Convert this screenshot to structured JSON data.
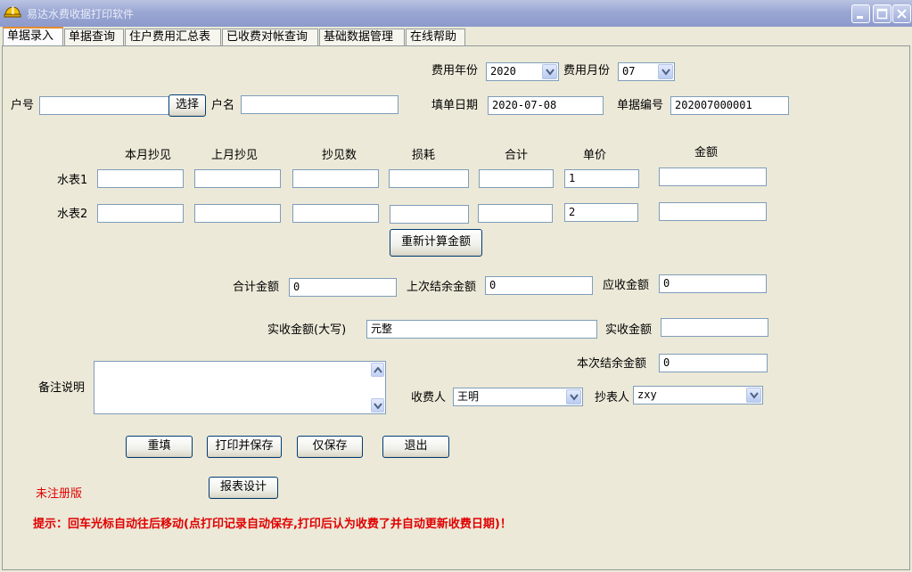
{
  "window": {
    "title": "易达水费收据打印软件"
  },
  "tabs": [
    {
      "label": "单据录入",
      "active": true
    },
    {
      "label": "单据查询"
    },
    {
      "label": "住户费用汇总表"
    },
    {
      "label": "已收费对帐查询"
    },
    {
      "label": "基础数据管理"
    },
    {
      "label": "在线帮助"
    }
  ],
  "form": {
    "fee_year_label": "费用年份",
    "fee_year_value": "2020",
    "fee_month_label": "费用月份",
    "fee_month_value": "07",
    "account_no_label": "户号",
    "account_no_value": "",
    "select_button": "选择",
    "account_name_label": "户名",
    "account_name_value": "",
    "fill_date_label": "填单日期",
    "fill_date_value": "2020-07-08",
    "doc_no_label": "单据编号",
    "doc_no_value": "202007000001"
  },
  "meter_table": {
    "headers": [
      "本月抄见",
      "上月抄见",
      "抄见数",
      "损耗",
      "合计",
      "单价",
      "金额"
    ],
    "rows": [
      {
        "label": "水表1",
        "values": [
          "",
          "",
          "",
          "",
          "",
          "1",
          ""
        ]
      },
      {
        "label": "水表2",
        "values": [
          "",
          "",
          "",
          "",
          "",
          "2",
          ""
        ]
      }
    ],
    "recalc_button": "重新计算金额"
  },
  "totals": {
    "total_amount_label": "合计金额",
    "total_amount_value": "0",
    "last_balance_label": "上次结余金额",
    "last_balance_value": "0",
    "receivable_label": "应收金额",
    "receivable_value": "0",
    "paid_upper_label": "实收金额(大写)",
    "paid_upper_value": "元整",
    "paid_label": "实收金额",
    "paid_value": "",
    "this_balance_label": "本次结余金额",
    "this_balance_value": "0"
  },
  "remark": {
    "label": "备注说明",
    "value": ""
  },
  "people": {
    "collector_label": "收费人",
    "collector_value": "王明",
    "reader_label": "抄表人",
    "reader_value": "zxy"
  },
  "actions": {
    "reset": "重填",
    "print_save": "打印并保存",
    "save_only": "仅保存",
    "exit": "退出",
    "report_design": "报表设计"
  },
  "status": {
    "unregistered": "未注册版",
    "hint": "提示：回车光标自动往后移动(点打印记录自动保存,打印后认为收费了并自动更新收费日期)！"
  },
  "colors": {
    "accent_tab": "#e68b2c",
    "warning_text": "#e00000",
    "panel_bg": "#ece9d8"
  },
  "icons": [
    "app-helmet-icon",
    "minimize-icon",
    "maximize-icon",
    "close-icon",
    "chevron-down-icon",
    "scroll-up-icon",
    "scroll-down-icon"
  ]
}
